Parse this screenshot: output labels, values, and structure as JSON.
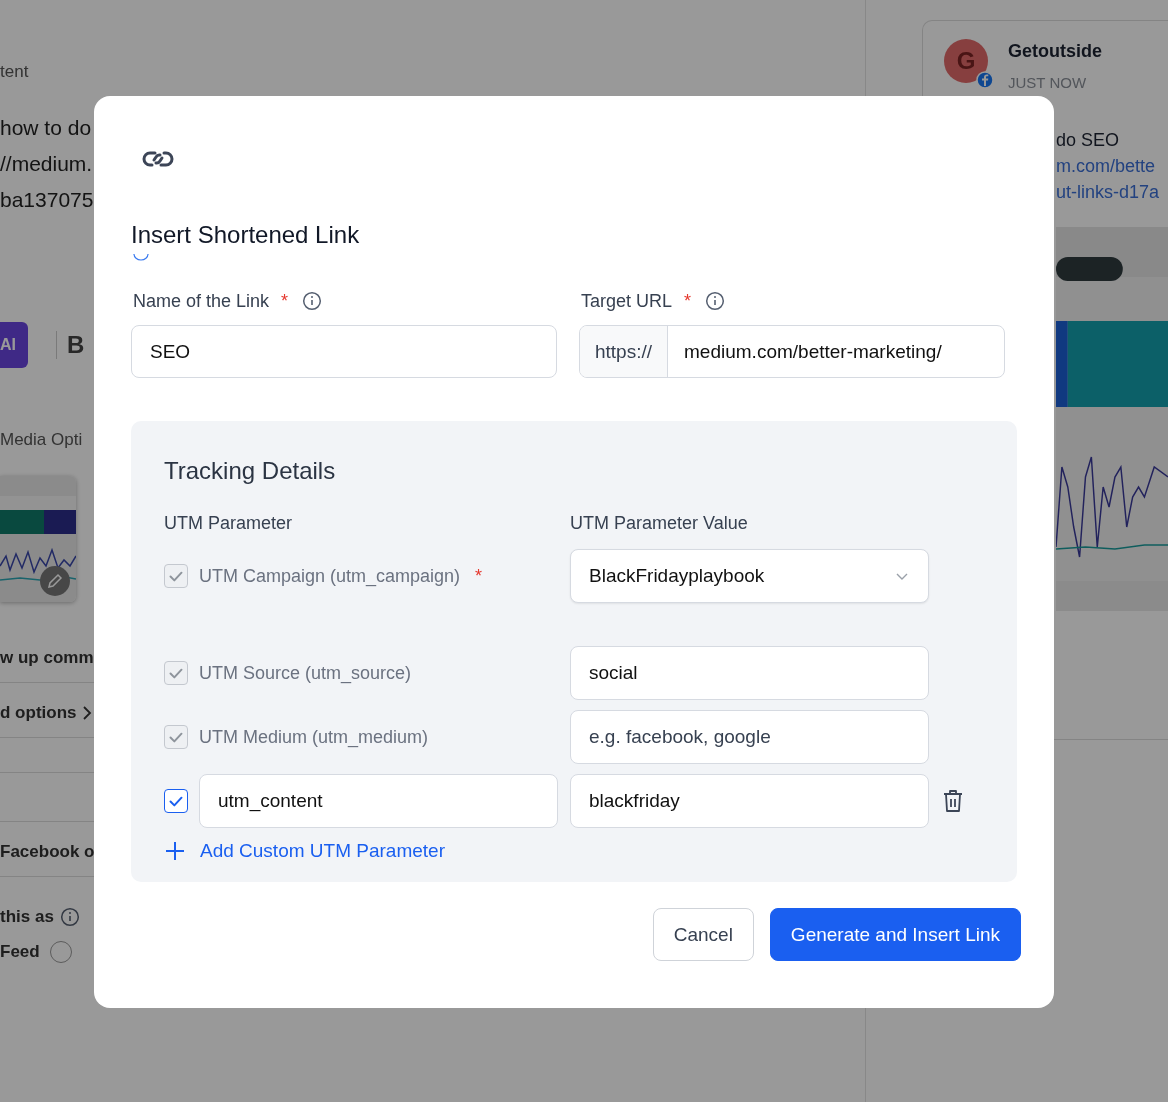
{
  "background": {
    "left_items": [
      {
        "kind": "label",
        "text": "tent"
      },
      {
        "kind": "body",
        "text": "how to do"
      },
      {
        "kind": "body",
        "text": "//medium."
      },
      {
        "kind": "body",
        "text": "ba137075"
      },
      {
        "kind": "toolbar",
        "ai": "AI",
        "bold": "B"
      },
      {
        "kind": "label",
        "text": "Media Opti"
      },
      {
        "kind": "picture"
      },
      {
        "kind": "row",
        "text": "w up comm"
      },
      {
        "kind": "chevron_row",
        "text": "d options"
      },
      {
        "kind": "blank_row"
      },
      {
        "kind": "row",
        "text": "Facebook o"
      },
      {
        "kind": "info",
        "text": "this as"
      },
      {
        "kind": "radio",
        "text": "Feed",
        "selected": false
      }
    ],
    "preview": {
      "avatar": "G",
      "name": "Getoutside",
      "time": "JUST NOW",
      "lines": [
        {
          "kind": "text",
          "text": "do SEO"
        },
        {
          "kind": "link",
          "text": "m.com/bette"
        },
        {
          "kind": "link",
          "text": "ut-links-d17a"
        }
      ]
    }
  },
  "modal": {
    "title": "Insert Shortened Link",
    "name_field": {
      "label": "Name of the Link",
      "required_mark": "*",
      "value": "SEO"
    },
    "url_field": {
      "label": "Target URL",
      "required_mark": "*",
      "prefix": "https://",
      "value": "medium.com/better-marketing/"
    },
    "tracking": {
      "title": "Tracking Details",
      "col_param": "UTM Parameter",
      "col_value": "UTM Parameter Value",
      "rows": [
        {
          "kind": "select",
          "label": "UTM Campaign (utm_campaign)",
          "required_mark": "*",
          "checked": true,
          "disabled": true,
          "value": "BlackFridayplaybook"
        },
        {
          "kind": "input",
          "label": "UTM Source (utm_source)",
          "checked": true,
          "disabled": true,
          "value": "social"
        },
        {
          "kind": "input",
          "label": "UTM Medium (utm_medium)",
          "checked": true,
          "disabled": true,
          "placeholder": "e.g. facebook, google"
        },
        {
          "kind": "custom",
          "name": "utm_content",
          "checked": true,
          "disabled": false,
          "value": "blackfriday"
        }
      ],
      "add_label": "Add Custom UTM Parameter"
    },
    "buttons": [
      {
        "kind": "secondary",
        "label": "Cancel"
      },
      {
        "kind": "primary",
        "label": "Generate and Insert Link"
      }
    ]
  }
}
